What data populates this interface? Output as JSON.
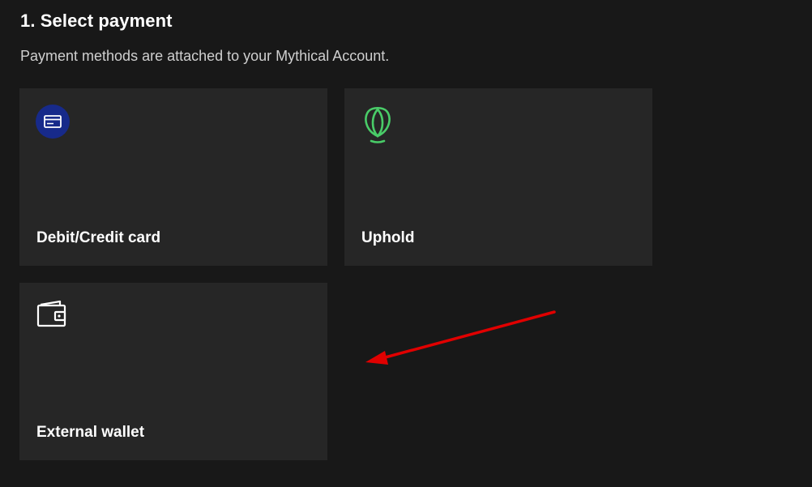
{
  "section": {
    "title": "1. Select payment",
    "subtitle": "Payment methods are attached to your Mythical Account."
  },
  "payment_methods": [
    {
      "label": "Debit/Credit card",
      "icon": "credit-card-icon",
      "icon_bg": "#172a8a"
    },
    {
      "label": "Uphold",
      "icon": "uphold-logo-icon",
      "icon_color": "#49cc68"
    },
    {
      "label": "External wallet",
      "icon": "wallet-icon"
    }
  ],
  "annotation": {
    "type": "arrow",
    "color": "#e00000",
    "points_to": "empty-area-right-of-external-wallet"
  },
  "colors": {
    "background": "#181818",
    "card": "#262626",
    "text": "#ffffff",
    "subtext": "#cfcfcf"
  }
}
